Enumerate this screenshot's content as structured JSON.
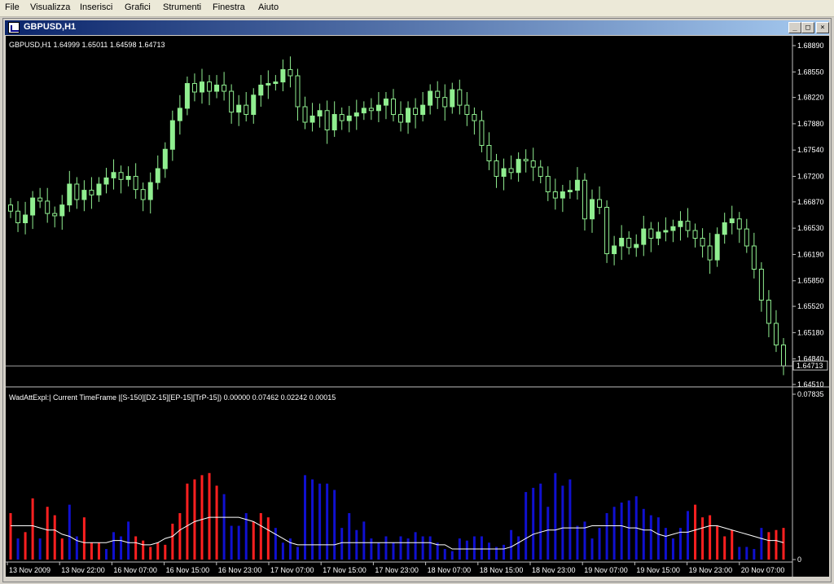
{
  "menu": [
    "File",
    "Visualizza",
    "Inserisci",
    "Grafici",
    "Strumenti",
    "Finestra",
    "Aiuto"
  ],
  "window": {
    "title": "GBPUSD,H1",
    "btn_min": "_",
    "btn_max": "□",
    "btn_close": "×"
  },
  "price_info": "GBPUSD,H1  1.64999 1.65011 1.64598 1.64713",
  "price_axis": [
    "1.68890",
    "1.68550",
    "1.68220",
    "1.67880",
    "1.67540",
    "1.67200",
    "1.66870",
    "1.66530",
    "1.66190",
    "1.65850",
    "1.65520",
    "1.65180",
    "1.64840",
    "1.64510"
  ],
  "current_price": "1.64713",
  "indicator_info": "WadAttExpl:| Current TimeFrame |[S-150][DZ-15][EP-15][TrP-15]) 0.00000 0.07462 0.02242 0.00015",
  "indicator_axis": [
    "0.07835",
    "0"
  ],
  "time_axis": [
    "13 Nov 2009",
    "13 Nov 22:00",
    "16 Nov 07:00",
    "16 Nov 15:00",
    "16 Nov 23:00",
    "17 Nov 07:00",
    "17 Nov 15:00",
    "17 Nov 23:00",
    "18 Nov 07:00",
    "18 Nov 15:00",
    "18 Nov 23:00",
    "19 Nov 07:00",
    "19 Nov 15:00",
    "19 Nov 23:00",
    "20 Nov 07:00"
  ],
  "colors": {
    "bull": "#90ee90",
    "bear": "#000000",
    "wick": "#90ee90",
    "up_bar": "#ff2020",
    "down_bar": "#1010d0",
    "line": "#ffffff"
  },
  "chart_data": [
    {
      "type": "candlestick",
      "title": "GBPUSD,H1",
      "ylim": [
        1.6451,
        1.6889
      ],
      "closes": [
        1.6675,
        1.666,
        1.667,
        1.6692,
        1.6688,
        1.6672,
        1.6669,
        1.6683,
        1.671,
        1.669,
        1.6702,
        1.6696,
        1.671,
        1.6718,
        1.6725,
        1.6716,
        1.672,
        1.6703,
        1.669,
        1.6712,
        1.673,
        1.6755,
        1.6792,
        1.6808,
        1.684,
        1.6829,
        1.6842,
        1.683,
        1.6838,
        1.683,
        1.6803,
        1.6812,
        1.68,
        1.6825,
        1.6838,
        1.684,
        1.6842,
        1.6858,
        1.685,
        1.681,
        1.679,
        1.6798,
        1.6805,
        1.678,
        1.68,
        1.6792,
        1.6798,
        1.6802,
        1.6808,
        1.6805,
        1.6812,
        1.682,
        1.68,
        1.679,
        1.6808,
        1.68,
        1.6812,
        1.683,
        1.6822,
        1.681,
        1.6832,
        1.6812,
        1.68,
        1.6792,
        1.676,
        1.674,
        1.672,
        1.673,
        1.6725,
        1.6742,
        1.674,
        1.6732,
        1.672,
        1.67,
        1.6692,
        1.67,
        1.6702,
        1.6715,
        1.6665,
        1.669,
        1.668,
        1.662,
        1.663,
        1.664,
        1.6628,
        1.6632,
        1.6652,
        1.664,
        1.6648,
        1.665,
        1.6655,
        1.6662,
        1.665,
        1.664,
        1.663,
        1.6612,
        1.6645,
        1.666,
        1.6665,
        1.6652,
        1.663,
        1.66,
        1.656,
        1.653,
        1.6502,
        1.6475
      ],
      "series_note": "",
      "tick_labels": [
        "1.68890",
        "1.68550",
        "1.68220",
        "1.67880",
        "1.67540",
        "1.67200",
        "1.66870",
        "1.66530",
        "1.66190",
        "1.65850",
        "1.65520",
        "1.65180",
        "1.64840",
        "1.64510"
      ]
    },
    {
      "type": "bar",
      "title": "WadAttExpl:| Current TimeFrame |[S-150][DZ-15][EP-15][TrP-15])",
      "ylim": [
        0,
        0.07835
      ],
      "values": [
        0.022,
        0.01,
        0.013,
        0.029,
        0.01,
        0.025,
        0.021,
        0.01,
        0.026,
        0.011,
        0.02,
        0.008,
        0.008,
        0.005,
        0.013,
        0.011,
        0.018,
        0.011,
        0.009,
        0.006,
        0.008,
        0.007,
        0.017,
        0.022,
        0.036,
        0.038,
        0.04,
        0.041,
        0.035,
        0.031,
        0.016,
        0.016,
        0.022,
        0.018,
        0.022,
        0.02,
        0.015,
        0.008,
        0.01,
        0.006,
        0.04,
        0.038,
        0.036,
        0.036,
        0.033,
        0.015,
        0.022,
        0.014,
        0.018,
        0.01,
        0.008,
        0.011,
        0.008,
        0.011,
        0.01,
        0.013,
        0.011,
        0.011,
        0.008,
        0.005,
        0.004,
        0.01,
        0.009,
        0.011,
        0.011,
        0.008,
        0.006,
        0.007,
        0.014,
        0.011,
        0.032,
        0.034,
        0.036,
        0.025,
        0.041,
        0.035,
        0.038,
        0.016,
        0.018,
        0.01,
        0.015,
        0.022,
        0.025,
        0.027,
        0.028,
        0.03,
        0.024,
        0.021,
        0.02,
        0.015,
        0.01,
        0.015,
        0.023,
        0.026,
        0.02,
        0.021,
        0.016,
        0.011,
        0.014,
        0.006,
        0.006,
        0.005,
        0.015,
        0.013,
        0.014,
        0.015
      ],
      "direction": [
        1,
        0,
        1,
        1,
        0,
        1,
        1,
        1,
        0,
        0,
        1,
        1,
        1,
        0,
        0,
        0,
        0,
        1,
        1,
        1,
        1,
        1,
        1,
        1,
        1,
        1,
        1,
        1,
        1,
        0,
        0,
        0,
        0,
        1,
        1,
        1,
        0,
        0,
        0,
        0,
        0,
        0,
        0,
        0,
        0,
        0,
        0,
        0,
        0,
        0,
        0,
        0,
        0,
        0,
        0,
        0,
        0,
        0,
        0,
        0,
        0,
        0,
        0,
        0,
        0,
        0,
        0,
        0,
        0,
        0,
        0,
        0,
        0,
        0,
        0,
        0,
        0,
        0,
        0,
        0,
        0,
        0,
        0,
        0,
        0,
        0,
        0,
        0,
        0,
        0,
        0,
        0,
        0,
        1,
        1,
        1,
        1,
        1,
        1,
        0,
        0,
        0,
        0,
        1,
        1,
        1
      ],
      "line": [
        0.016,
        0.016,
        0.016,
        0.016,
        0.015,
        0.014,
        0.014,
        0.012,
        0.011,
        0.009,
        0.008,
        0.008,
        0.008,
        0.008,
        0.009,
        0.009,
        0.008,
        0.008,
        0.007,
        0.007,
        0.008,
        0.01,
        0.011,
        0.014,
        0.016,
        0.018,
        0.019,
        0.02,
        0.02,
        0.02,
        0.02,
        0.02,
        0.019,
        0.018,
        0.016,
        0.014,
        0.012,
        0.01,
        0.008,
        0.007,
        0.007,
        0.007,
        0.007,
        0.007,
        0.007,
        0.008,
        0.008,
        0.008,
        0.008,
        0.008,
        0.008,
        0.008,
        0.008,
        0.008,
        0.008,
        0.008,
        0.008,
        0.008,
        0.007,
        0.007,
        0.005,
        0.005,
        0.005,
        0.005,
        0.005,
        0.005,
        0.005,
        0.005,
        0.006,
        0.008,
        0.01,
        0.012,
        0.013,
        0.014,
        0.014,
        0.015,
        0.015,
        0.015,
        0.015,
        0.016,
        0.016,
        0.016,
        0.016,
        0.016,
        0.015,
        0.015,
        0.014,
        0.014,
        0.012,
        0.011,
        0.012,
        0.013,
        0.013,
        0.014,
        0.015,
        0.016,
        0.016,
        0.015,
        0.014,
        0.013,
        0.012,
        0.011,
        0.01,
        0.009,
        0.009,
        0.008
      ],
      "tick_labels": [
        "0.07835",
        "0"
      ]
    }
  ]
}
